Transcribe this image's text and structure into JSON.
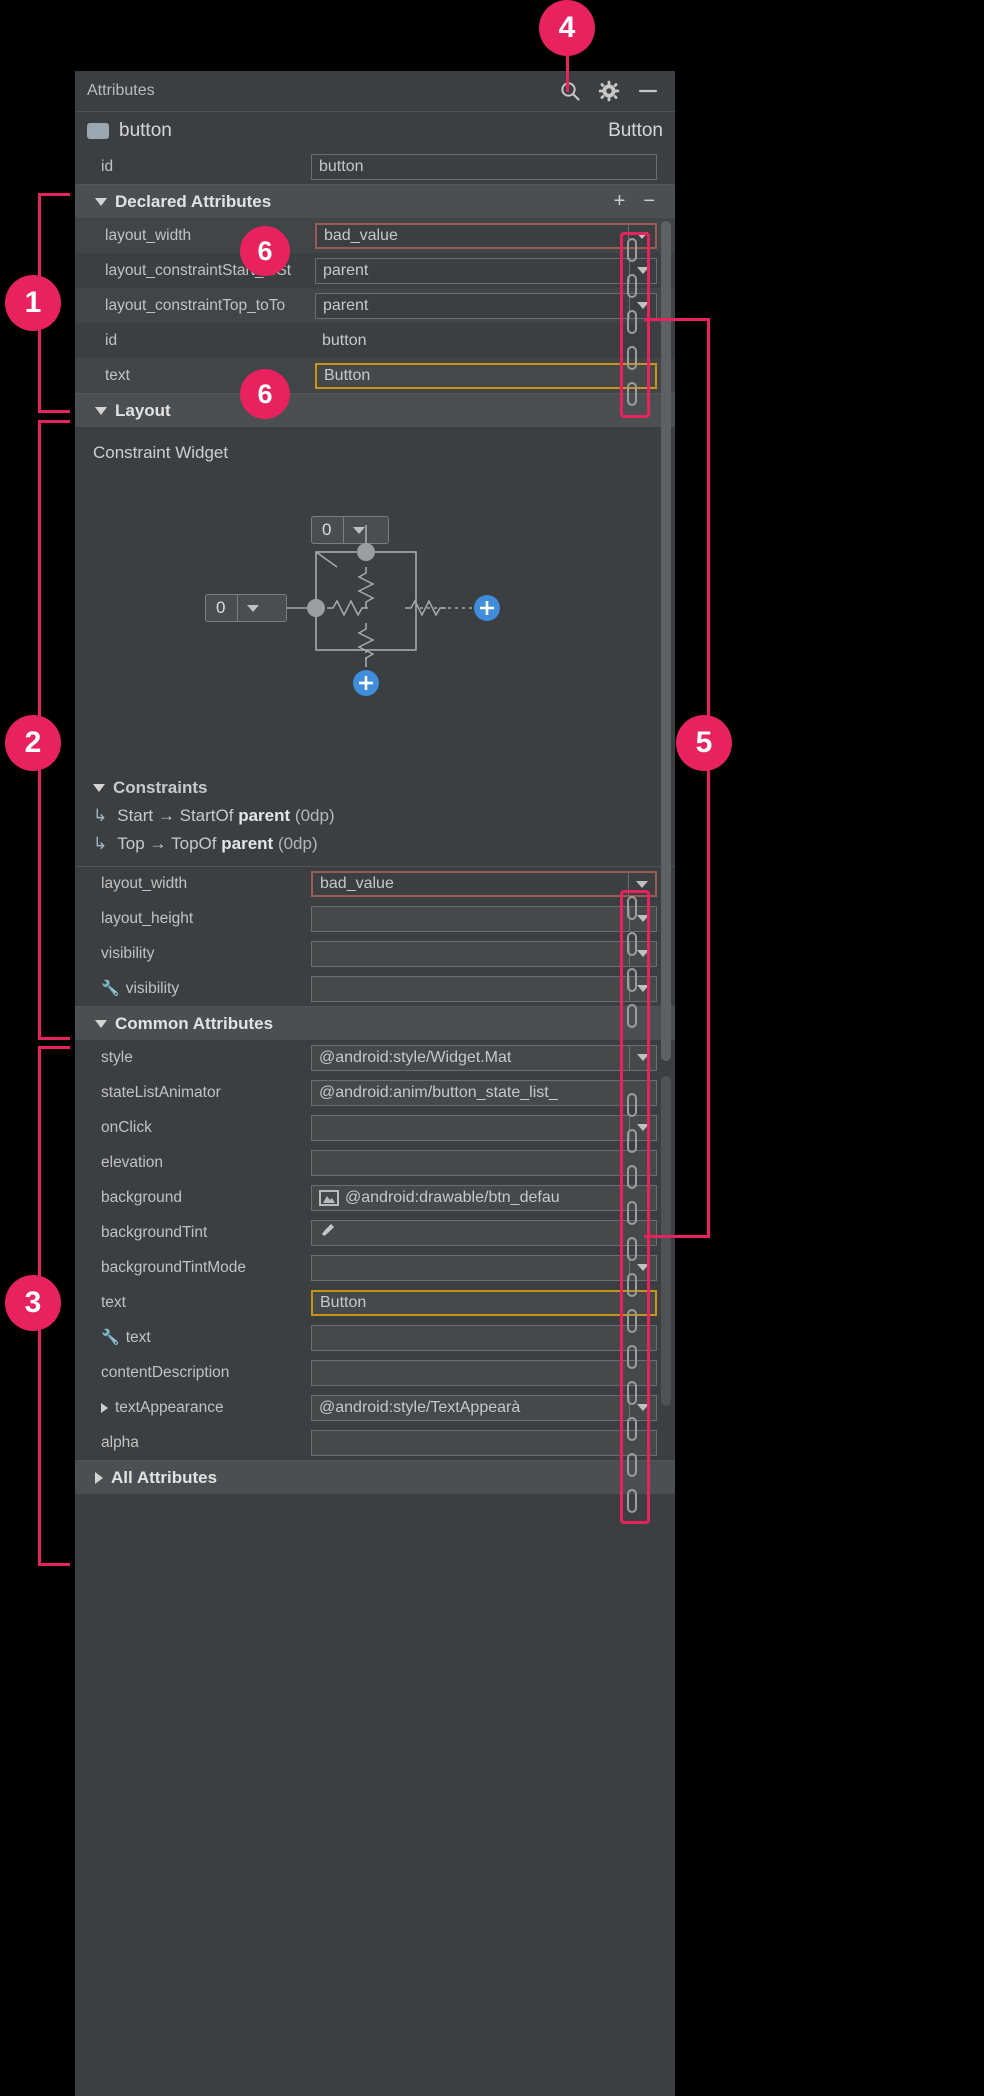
{
  "panel": {
    "title": "Attributes",
    "icons": [
      "search-icon",
      "gear-icon",
      "minimize-icon"
    ]
  },
  "widget": {
    "name": "button",
    "type": "Button"
  },
  "id_row": {
    "label": "id",
    "value": "button"
  },
  "declared": {
    "section_title": "Declared Attributes",
    "add_label": "+",
    "remove_label": "−",
    "rows": [
      {
        "label": "layout_width",
        "value": "bad_value",
        "state": "error",
        "dropdown": true
      },
      {
        "label": "layout_constraintStart_toSt",
        "value": "parent",
        "state": "normal",
        "dropdown": true
      },
      {
        "label": "layout_constraintTop_toTo",
        "value": "parent",
        "state": "normal",
        "dropdown": true
      },
      {
        "label": "id",
        "value": "button",
        "state": "flat",
        "dropdown": false
      },
      {
        "label": "text",
        "value": "Button",
        "state": "warn",
        "dropdown": false
      }
    ]
  },
  "layout": {
    "section_title": "Layout",
    "constraint_widget_title": "Constraint Widget",
    "top_margin": "0",
    "left_margin": "0",
    "constraints_title": "Constraints",
    "constraints": [
      {
        "from": "Start",
        "arrow": "→",
        "to": "StartOf",
        "target": "parent",
        "value": "(0dp)"
      },
      {
        "from": "Top",
        "arrow": "→",
        "to": "TopOf",
        "target": "parent",
        "value": "(0dp)"
      }
    ],
    "rows": [
      {
        "label": "layout_width",
        "value": "bad_value",
        "state": "error",
        "dropdown": true,
        "wrench": false
      },
      {
        "label": "layout_height",
        "value": "",
        "state": "normal",
        "dropdown": true,
        "wrench": false
      },
      {
        "label": "visibility",
        "value": "",
        "state": "normal",
        "dropdown": true,
        "wrench": false
      },
      {
        "label": "visibility",
        "value": "",
        "state": "normal",
        "dropdown": true,
        "wrench": true
      }
    ]
  },
  "common": {
    "section_title": "Common Attributes",
    "rows": [
      {
        "label": "style",
        "value": "@android:style/Widget.Mat",
        "state": "normal",
        "dropdown": true,
        "wrench": false,
        "img": false
      },
      {
        "label": "stateListAnimator",
        "value": "@android:anim/button_state_list_",
        "state": "normal",
        "dropdown": false,
        "wrench": false,
        "img": false
      },
      {
        "label": "onClick",
        "value": "",
        "state": "normal",
        "dropdown": true,
        "wrench": false,
        "img": false
      },
      {
        "label": "elevation",
        "value": "",
        "state": "normal",
        "dropdown": false,
        "wrench": false,
        "img": false
      },
      {
        "label": "background",
        "value": "@android:drawable/btn_defau",
        "state": "normal",
        "dropdown": false,
        "wrench": false,
        "img": true
      },
      {
        "label": "backgroundTint",
        "value": "",
        "state": "normal",
        "dropdown": false,
        "wrench": false,
        "img": false,
        "picker": true
      },
      {
        "label": "backgroundTintMode",
        "value": "",
        "state": "normal",
        "dropdown": true,
        "wrench": false,
        "img": false
      },
      {
        "label": "text",
        "value": "Button",
        "state": "warn",
        "dropdown": false,
        "wrench": false,
        "img": false
      },
      {
        "label": "text",
        "value": "",
        "state": "normal",
        "dropdown": false,
        "wrench": true,
        "img": false
      },
      {
        "label": "contentDescription",
        "value": "",
        "state": "normal",
        "dropdown": false,
        "wrench": false,
        "img": false
      },
      {
        "label": "textAppearance",
        "value": "@android:style/TextAppearà",
        "state": "normal",
        "dropdown": true,
        "wrench": false,
        "img": false,
        "expand": true
      },
      {
        "label": "alpha",
        "value": "",
        "state": "normal",
        "dropdown": false,
        "wrench": false,
        "img": false
      }
    ]
  },
  "all_attributes": {
    "section_title": "All Attributes"
  },
  "annotations": {
    "callouts": [
      {
        "number": "1"
      },
      {
        "number": "2"
      },
      {
        "number": "3"
      },
      {
        "number": "4"
      },
      {
        "number": "5"
      },
      {
        "number": "6"
      },
      {
        "number": "6"
      }
    ],
    "accent_color": "#e8225f"
  }
}
